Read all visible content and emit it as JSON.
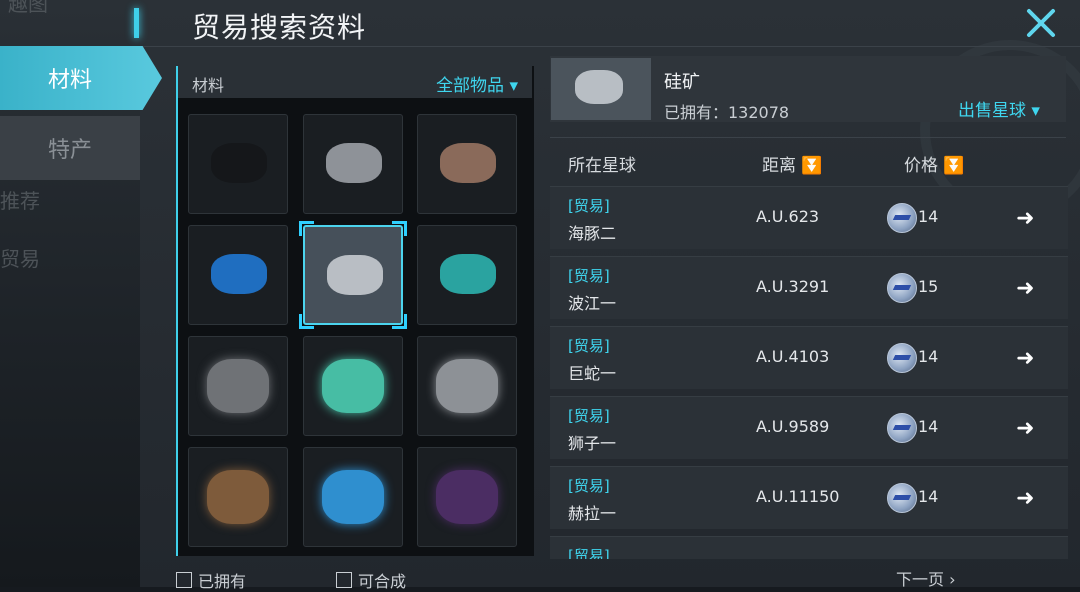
{
  "window": {
    "title": "贸易搜索资料"
  },
  "tabs": [
    {
      "label": "材料",
      "active": true
    },
    {
      "label": "特产",
      "active": false
    }
  ],
  "background_text": {
    "top": "趣图",
    "mid": "推荐",
    "low": "贸易"
  },
  "grid": {
    "header_label": "材料",
    "filter_label": "全部物品 ▾",
    "cells": [
      {
        "name": "dark-ore",
        "color": "#15171a"
      },
      {
        "name": "gray-ore",
        "color": "#8e9298"
      },
      {
        "name": "copper-ore",
        "color": "#8a6a5a"
      },
      {
        "name": "blue-ore",
        "color": "#1f6ec0"
      },
      {
        "name": "silicon-ore",
        "color": "#b9bec4",
        "selected": true
      },
      {
        "name": "teal-ore",
        "color": "#2aa3a0"
      },
      {
        "name": "gray-dust",
        "color": "#6f7276"
      },
      {
        "name": "green-dust",
        "color": "#47bda4"
      },
      {
        "name": "silver-dust",
        "color": "#8d9196"
      },
      {
        "name": "brown-dust",
        "color": "#7e5b3b"
      },
      {
        "name": "blue-dust",
        "color": "#2f8fcf"
      },
      {
        "name": "purple-dust",
        "color": "#4b2d63"
      }
    ]
  },
  "filters": {
    "owned": "已拥有",
    "craftable": "可合成"
  },
  "item": {
    "name": "硅矿",
    "owned": "已拥有：132078",
    "sell": "出售星球 ▾"
  },
  "columns": {
    "planet": "所在星球",
    "distance": "距离",
    "price": "价格"
  },
  "rows": [
    {
      "tag": "[贸易]",
      "planet": "海豚二",
      "distance": "A.U.623",
      "price": "14"
    },
    {
      "tag": "[贸易]",
      "planet": "波江一",
      "distance": "A.U.3291",
      "price": "15"
    },
    {
      "tag": "[贸易]",
      "planet": "巨蛇一",
      "distance": "A.U.4103",
      "price": "14"
    },
    {
      "tag": "[贸易]",
      "planet": "狮子一",
      "distance": "A.U.9589",
      "price": "14"
    },
    {
      "tag": "[贸易]",
      "planet": "赫拉一",
      "distance": "A.U.11150",
      "price": "14"
    },
    {
      "tag": "[贸易]",
      "planet": "",
      "distance": "",
      "price": ""
    }
  ],
  "pager": {
    "next": "下一页 ›"
  }
}
